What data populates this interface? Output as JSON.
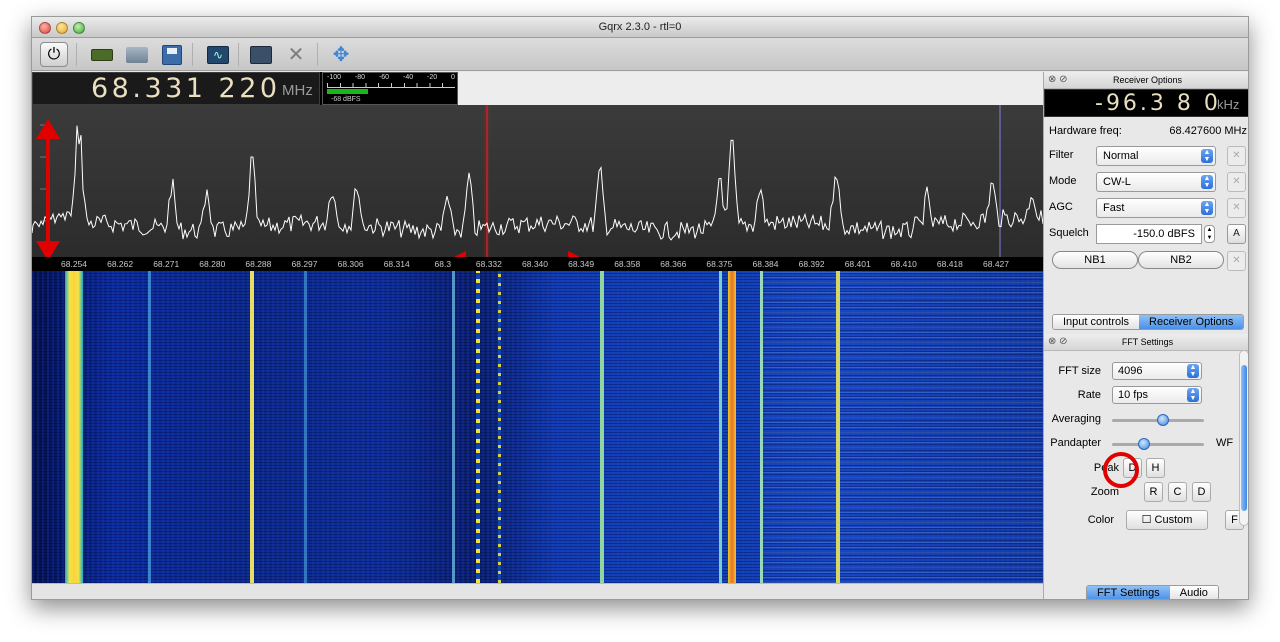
{
  "window": {
    "title": "Gqrx 2.3.0 - rtl=0"
  },
  "toolbar": {
    "icons": [
      "power-icon",
      "device-icon",
      "folder-icon",
      "save-icon",
      "scope-icon",
      "network-icon",
      "tools-icon",
      "move-icon"
    ]
  },
  "frequency": {
    "value": "68.331 220",
    "unit": "MHz"
  },
  "meter": {
    "ticks": [
      "-100",
      "-80",
      "-60",
      "-40",
      "-20",
      "0"
    ],
    "value": "-68 dBFS",
    "level_dbfs": -68
  },
  "freq_scale": {
    "ticks": [
      "68.254",
      "68.262",
      "68.271",
      "68.280",
      "68.288",
      "68.297",
      "68.306",
      "68.314",
      "68.3",
      "68.332",
      "68.340",
      "68.349",
      "68.358",
      "68.366",
      "68.375",
      "68.384",
      "68.392",
      "68.401",
      "68.410",
      "68.418",
      "68.427"
    ]
  },
  "receiver": {
    "title": "Receiver Options",
    "offset_value": "-96.3 8 0",
    "offset_unit": "kHz",
    "hw_label": "Hardware freq:",
    "hw_value": "68.427600 MHz",
    "filter_label": "Filter",
    "filter_value": "Normal",
    "mode_label": "Mode",
    "mode_value": "CW-L",
    "agc_label": "AGC",
    "agc_value": "Fast",
    "squelch_label": "Squelch",
    "squelch_value": "-150.0 dBFS",
    "squelch_btn": "A",
    "nb1": "NB1",
    "nb2": "NB2"
  },
  "tabs_top": [
    "Input controls",
    "Receiver Options"
  ],
  "fft": {
    "title": "FFT Settings",
    "size_label": "FFT size",
    "size_value": "4096",
    "rate_label": "Rate",
    "rate_value": "10 fps",
    "avg_label": "Averaging",
    "avg_level": 0.55,
    "pand_label": "Pandapter",
    "pand_level": 0.35,
    "pand_right": "WF",
    "peak_label": "Peak",
    "peak_d": "D",
    "peak_h": "H",
    "zoom_label": "Zoom",
    "zoom_r": "R",
    "zoom_c": "C",
    "zoom_d": "D",
    "color_label": "Color",
    "color_custom": "Custom",
    "color_f": "F"
  },
  "tabs_bottom": [
    "FFT Settings",
    "Audio"
  ],
  "colors": {
    "accent": "#4a90e8",
    "annotation": "#e00000",
    "spectrum": "#ffffff"
  }
}
